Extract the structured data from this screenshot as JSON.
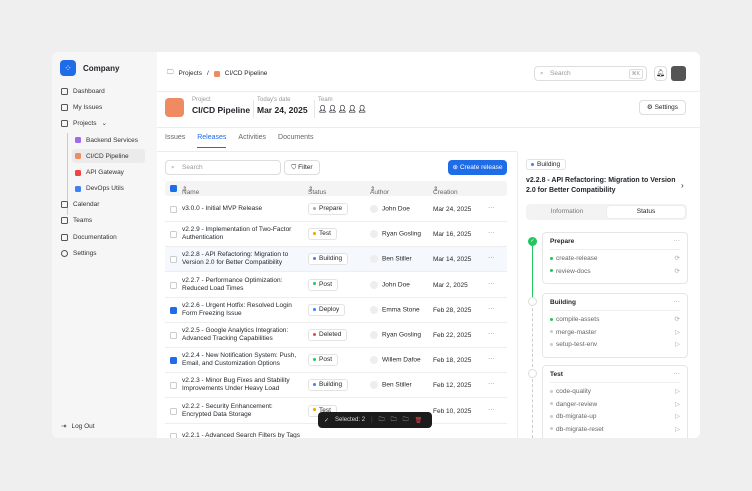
{
  "sidebar": {
    "brand": "Company",
    "items": [
      {
        "label": "Dashboard"
      },
      {
        "label": "My Issues"
      },
      {
        "label": "Projects"
      }
    ],
    "projects": [
      {
        "label": "Backend Services",
        "color": "#9b6cf0"
      },
      {
        "label": "CI/CD Pipeline",
        "color": "#f08a63"
      },
      {
        "label": "API Gateway",
        "color": "#ef4444"
      },
      {
        "label": "DevOps Utils",
        "color": "#3b82f6"
      }
    ],
    "bottom": [
      {
        "label": "Calendar"
      },
      {
        "label": "Teams"
      },
      {
        "label": "Documentation"
      },
      {
        "label": "Settings"
      }
    ],
    "logout": "Log Out"
  },
  "header": {
    "crumb_root": "Projects",
    "crumb_sep": "/",
    "crumb_current": "CI/CD Pipeline",
    "search_placeholder": "Search",
    "shortcut": "⌘K"
  },
  "project": {
    "label": "Project",
    "name": "CI/CD Pipeline",
    "date_label": "Today's date",
    "date": "Mar 24, 2025",
    "team_label": "Team",
    "settings": "Settings"
  },
  "tabs": [
    "Issues",
    "Releases",
    "Activities",
    "Documents"
  ],
  "toolbar": {
    "search_placeholder": "Search",
    "filter": "Filter",
    "create": "Create release"
  },
  "columns": [
    "Name",
    "Status",
    "Author",
    "Creation"
  ],
  "rows": [
    {
      "name": "v3.0.0 - Initial MVP Release",
      "status": "Prepare",
      "color": "#aaaaaa",
      "author": "John Doe",
      "date": "Mar 24, 2025"
    },
    {
      "name": "v2.2.9 - Implementation of Two-Factor Authentication",
      "status": "Test",
      "color": "#f59e0b",
      "author": "Ryan Gosling",
      "date": "Mar 16, 2025"
    },
    {
      "name": "v2.2.8 - API Refactoring: Migration to Version 2.0 for Better Compatibility",
      "status": "Building",
      "color": "#3b82f6",
      "author": "Ben Stiller",
      "date": "Mar 14, 2025"
    },
    {
      "name": "v2.2.7 - Performance Optimization: Reduced Load Times",
      "status": "Post",
      "color": "#22c55e",
      "author": "John Doe",
      "date": "Mar 2, 2025"
    },
    {
      "name": "v2.2.6 - Urgent Hotfix: Resolved Login Form Freezing Issue",
      "status": "Deploy",
      "color": "#3b82f6",
      "author": "Emma Stone",
      "date": "Feb 28, 2025"
    },
    {
      "name": "v2.2.5 - Google Analytics Integration: Advanced Tracking Capabilities",
      "status": "Deleted",
      "color": "#ef4444",
      "author": "Ryan Gosling",
      "date": "Feb 22, 2025"
    },
    {
      "name": "v2.2.4 - New Notification System: Push, Email, and Customization Options",
      "status": "Post",
      "color": "#22c55e",
      "author": "Willem Dafoe",
      "date": "Feb 18, 2025"
    },
    {
      "name": "v2.2.3 - Minor Bug Fixes and Stability Improvements Under Heavy Load",
      "status": "Building",
      "color": "#3b82f6",
      "author": "Ben Stiller",
      "date": "Feb 12, 2025"
    },
    {
      "name": "v2.2.2 - Security Enhancement: Encrypted Data Storage",
      "status": "Test",
      "color": "#f59e0b",
      "author": "",
      "date": "Feb 10, 2025"
    },
    {
      "name": "v2.2.1 - Advanced Search Filters by Tags",
      "status": "",
      "color": "#aaaaaa",
      "author": "",
      "date": ""
    }
  ],
  "selected_rows": [
    4,
    6
  ],
  "selection_bar": {
    "label": "Selected: 2"
  },
  "detail": {
    "status": "Building",
    "title": "v2.2.8 - API Refactoring: Migration to Version 2.0 for Better Compatibility",
    "tabs": [
      "Information",
      "Status"
    ],
    "stages": [
      {
        "name": "Prepare",
        "steps": [
          {
            "n": "create-release",
            "done": true
          },
          {
            "n": "review-docs",
            "done": true
          }
        ]
      },
      {
        "name": "Building",
        "steps": [
          {
            "n": "compile-assets",
            "done": true
          },
          {
            "n": "merge-master",
            "done": false
          },
          {
            "n": "setup-test-env",
            "done": false
          }
        ]
      },
      {
        "name": "Test",
        "steps": [
          {
            "n": "code-quality",
            "done": false
          },
          {
            "n": "danger-review",
            "done": false
          },
          {
            "n": "db-migrate-up",
            "done": false
          },
          {
            "n": "db-migrate-reset",
            "done": false
          }
        ]
      }
    ]
  }
}
